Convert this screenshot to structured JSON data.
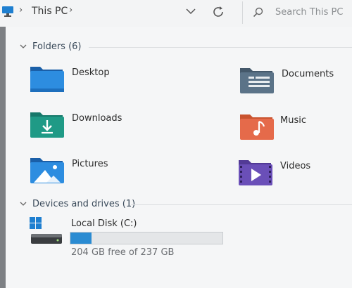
{
  "address_bar": {
    "location": "This PC",
    "search_placeholder": "Search This PC"
  },
  "icons": {
    "location": "computer-icon",
    "separators": "chevron-right-icon",
    "history": "chevron-down-icon",
    "refresh": "refresh-icon",
    "search": "search-icon"
  },
  "groups": {
    "folders_label": "Folders (6)",
    "devices_label": "Devices and drives (1)"
  },
  "folders": [
    {
      "name": "Desktop",
      "icon": "desktop-folder-icon"
    },
    {
      "name": "Documents",
      "icon": "documents-folder-icon"
    },
    {
      "name": "Downloads",
      "icon": "downloads-folder-icon"
    },
    {
      "name": "Music",
      "icon": "music-folder-icon"
    },
    {
      "name": "Pictures",
      "icon": "pictures-folder-icon"
    },
    {
      "name": "Videos",
      "icon": "videos-folder-icon"
    }
  ],
  "drive": {
    "name": "Local Disk (C:)",
    "free_text": "204 GB free of 237 GB",
    "used_fraction": 0.14,
    "icon": "windows-drive-icon"
  },
  "colors": {
    "accent": "#2a8bd2",
    "downloads": "#1f9a86",
    "music": "#e56a4a",
    "videos": "#6a4fb8",
    "documents": "#5b7388"
  }
}
